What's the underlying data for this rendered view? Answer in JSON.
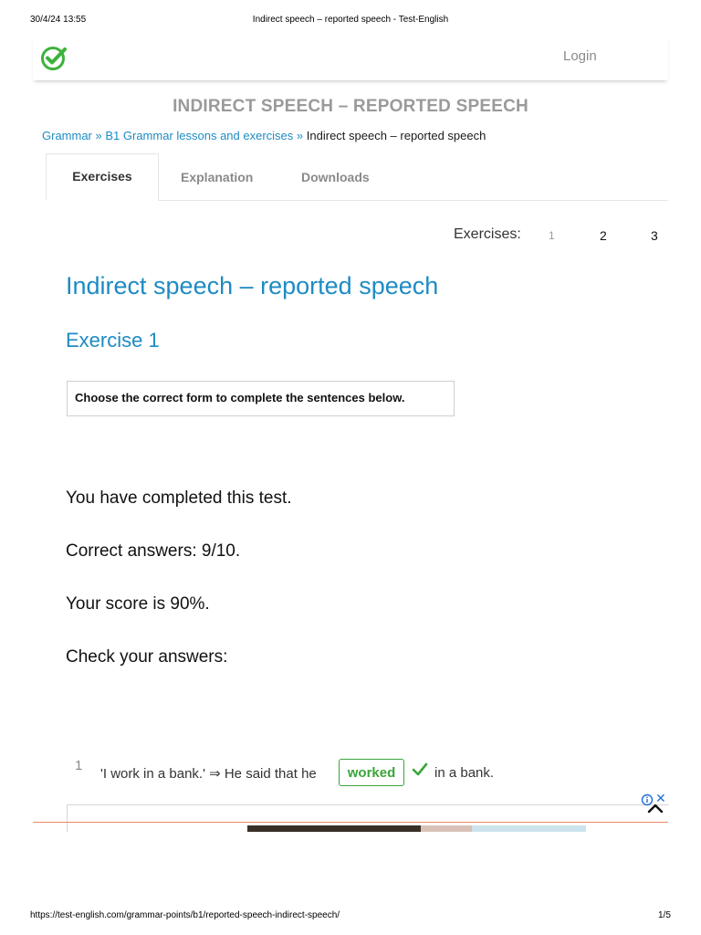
{
  "print_header": {
    "datetime": "30/4/24 13:55",
    "title": "Indirect speech – reported speech - Test-English"
  },
  "topbar": {
    "logo_icon": "green-checkmark-circle-icon",
    "login": "Login"
  },
  "page_heading": "INDIRECT SPEECH – REPORTED SPEECH",
  "breadcrumb": {
    "items": [
      "Grammar",
      "B1 Grammar lessons and exercises",
      "Indirect speech – reported speech"
    ],
    "separator": "»"
  },
  "tabs": [
    {
      "label": "Exercises",
      "active": true
    },
    {
      "label": "Explanation",
      "active": false
    },
    {
      "label": "Downloads",
      "active": false
    }
  ],
  "exercise_nav": {
    "label": "Exercises:",
    "numbers": [
      "1",
      "2",
      "3"
    ],
    "current": "1"
  },
  "main_title": "Indirect speech – reported speech",
  "exercise_title": "Exercise 1",
  "instruction": "Choose the correct form to complete the sentences below.",
  "results": {
    "completed": "You have completed this test.",
    "correct": "Correct answers: 9/10.",
    "score": "Your score is 90%.",
    "check": "Check your answers:"
  },
  "questions": [
    {
      "number": "1",
      "before": "'I work in a bank.' ⇒ He said that he",
      "answer": "worked",
      "status": "correct",
      "after": "in a bank."
    }
  ],
  "ad": {
    "info_icon": "info-icon",
    "close_icon": "close-icon",
    "collapse_icon": "chevron-up-icon"
  },
  "print_footer": {
    "url": "https://test-english.com/grammar-points/b1/reported-speech-indirect-speech/",
    "page": "1/5"
  },
  "colors": {
    "link_blue": "#1e8bc3",
    "correct_green": "#3aa53a",
    "logo_green": "#3bb33b",
    "muted_gray": "#8a8a8a"
  }
}
